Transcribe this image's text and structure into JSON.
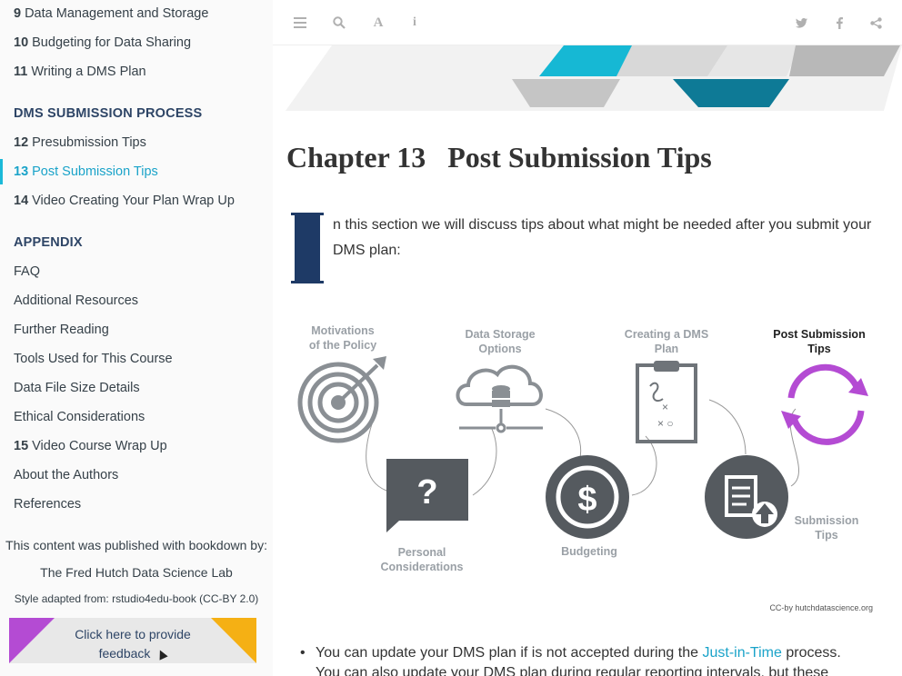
{
  "sidebar": {
    "items_top": [
      {
        "num": "9",
        "label": "Data Management and Storage"
      },
      {
        "num": "10",
        "label": "Budgeting for Data Sharing"
      },
      {
        "num": "11",
        "label": "Writing a DMS Plan"
      }
    ],
    "section1_header": "DMS SUBMISSION PROCESS",
    "items_mid": [
      {
        "num": "12",
        "label": "Presubmission Tips"
      },
      {
        "num": "13",
        "label": "Post Submission Tips"
      },
      {
        "num": "14",
        "label": "Video Creating Your Plan Wrap Up"
      }
    ],
    "section2_header": "APPENDIX",
    "appendix": [
      {
        "num": "",
        "label": "FAQ"
      },
      {
        "num": "",
        "label": "Additional Resources"
      },
      {
        "num": "",
        "label": "Further Reading"
      },
      {
        "num": "",
        "label": "Tools Used for This Course"
      },
      {
        "num": "",
        "label": "Data File Size Details"
      },
      {
        "num": "",
        "label": "Ethical Considerations"
      },
      {
        "num": "15",
        "label": "Video Course Wrap Up"
      },
      {
        "num": "",
        "label": "About the Authors"
      },
      {
        "num": "",
        "label": "References"
      }
    ],
    "published_by": "This content was published with bookdown by:",
    "lab_name": "The Fred Hutch Data Science Lab",
    "style_credit": "Style adapted from: rstudio4edu-book (CC-BY 2.0)",
    "feedback_label": "Click here to provide feedback"
  },
  "toolbar": {
    "icons_left": [
      "menu-icon",
      "search-icon",
      "font-icon",
      "info-icon"
    ],
    "icons_right": [
      "twitter-icon",
      "facebook-icon",
      "share-icon"
    ]
  },
  "chapter": {
    "number": "Chapter 13",
    "title": "Post Submission Tips",
    "dropcap_letter": "I",
    "intro": "n this section we will discuss tips about what might be needed after you submit your DMS plan:"
  },
  "figure": {
    "labels": {
      "motivations": [
        "Motivations",
        "of the Policy"
      ],
      "storage": [
        "Data Storage",
        "Options"
      ],
      "creating": [
        "Creating a DMS",
        "Plan"
      ],
      "post": [
        "Post Submission",
        "Tips"
      ],
      "personal": [
        "Personal",
        "Considerations"
      ],
      "budgeting": [
        "Budgeting"
      ],
      "submission": [
        "Submission",
        "Tips"
      ]
    },
    "credit": "CC-by hutchdatascience.org",
    "colors": {
      "gray": "#8a8f94",
      "purple": "#b44bd3",
      "dark": "#555a5f"
    }
  },
  "bullets": {
    "b1_before": "You can update your DMS plan if is not accepted during the ",
    "b1_link": "Just-in-Time",
    "b1_after": " process.",
    "b2": "You can also update your DMS plan during regular reporting intervals, but these"
  }
}
